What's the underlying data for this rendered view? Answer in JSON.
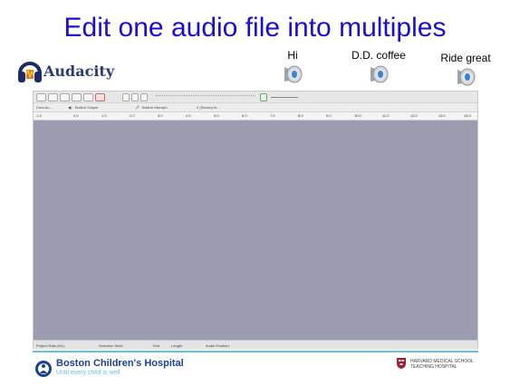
{
  "slide": {
    "title": "Edit one audio file into multiples"
  },
  "logo": {
    "word": "Audacity"
  },
  "audio_clips": [
    {
      "label": "Hi",
      "icon": "speaker-icon"
    },
    {
      "label": "D.D. coffee",
      "icon": "speaker-icon"
    },
    {
      "label": "Ride great",
      "icon": "speaker-icon"
    }
  ],
  "audacity": {
    "toolbar2": {
      "host": "Core Au...",
      "output": "Built-in Output",
      "input": "Built-in Microph",
      "channels": "2 (Stereo) In..."
    },
    "ruler_ticks": [
      "- 1.0",
      "0.0",
      "1.0",
      "2.0",
      "3.0",
      "4.0",
      "5.0",
      "6.0",
      "7.0",
      "8.0",
      "9.0",
      "10.0",
      "11.0",
      "12.0",
      "13.0",
      "14.0"
    ],
    "status": {
      "project_rate": "Project Rate (Hz):",
      "selection_start": "Selection Start:",
      "end": "End",
      "length": "Length",
      "audio_position": "Audio Position:"
    },
    "colors": {
      "track_area": "#9b9caf",
      "window_chrome": "#eeeeee"
    }
  },
  "footer": {
    "hospital_name": "Boston Children's Hospital",
    "hospital_tagline": "Until every child is well",
    "hms_line1": "HARVARD MEDICAL SCHOOL",
    "hms_line2": "TEACHING HOSPITAL",
    "accent_color": "#5ec2e6"
  }
}
